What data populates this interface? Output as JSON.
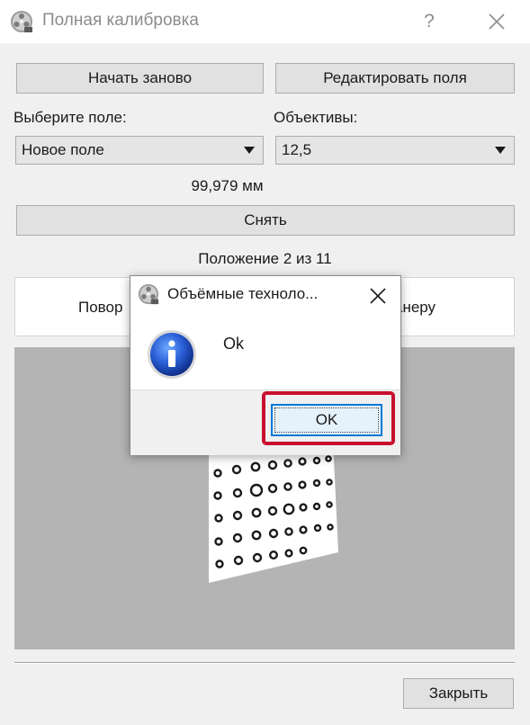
{
  "window": {
    "title": "Полная калибровка",
    "help_label": "?",
    "icon": "film-reel-icon",
    "close_icon": "close-icon"
  },
  "toolbar": {
    "restart_label": "Начать заново",
    "edit_fields_label": "Редактировать поля"
  },
  "field_select": {
    "label": "Выберите поле:",
    "selected": "Новое поле"
  },
  "lens_select": {
    "label": "Объективы:",
    "selected": "12,5"
  },
  "measurement": "99,979 мм",
  "capture_label": "Снять",
  "position_text": "Положение 2 из 11",
  "instruction": {
    "left_fragment": "Повор",
    "right_fragment": "анеру"
  },
  "footer": {
    "close_label": "Закрыть"
  },
  "message_box": {
    "title": "Объёмные техноло...",
    "icon": "info-icon",
    "text": "Ok",
    "ok_label": "OK",
    "highlight_color": "#c8102e"
  },
  "colors": {
    "accent": "#0078d7",
    "preview_background": "#b4b4b4"
  }
}
